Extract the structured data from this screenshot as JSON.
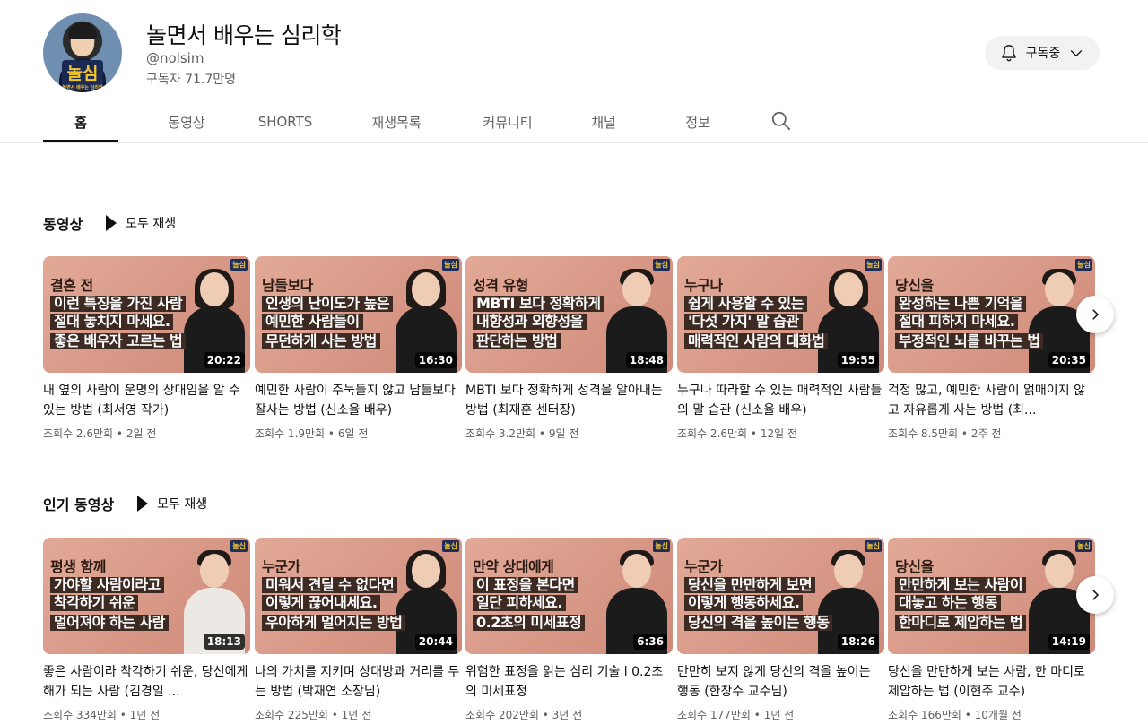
{
  "channel": {
    "avatar_text": "놀심",
    "avatar_subtext": "놀면서 배우는 심리학",
    "name": "놀면서 배우는 심리학",
    "handle": "@nolsim",
    "subscribers": "구독자 71.7만명",
    "subscribe_label": "구독중",
    "logo_badge": "놀심"
  },
  "tabs": [
    "홈",
    "동영상",
    "SHORTS",
    "재생목록",
    "커뮤니티",
    "채널",
    "정보"
  ],
  "icons": {
    "bell": "bell-icon",
    "chevron": "chevron-down-icon",
    "search": "search-icon",
    "play": "play-icon",
    "next": "chevron-right-icon"
  },
  "colors": {
    "thumb_bg": "#d79b8b",
    "text_secondary": "#606060",
    "subscribe_bg": "#f2f2f2"
  },
  "sections": [
    {
      "title": "동영상",
      "play_all": "모두 재생",
      "videos": [
        {
          "thumb_lines": [
            "결혼 전",
            "이런 특징을 가진 사람",
            "절대 놓치지 마세요.",
            "좋은 배우자 고르는 법"
          ],
          "duration": "20:22",
          "title": "내 옆의 사람이 운명의 상대임을 알 수 있는 방법 (최서영 작가)",
          "views": "조회수 2.6만회",
          "age": "2일 전"
        },
        {
          "thumb_lines": [
            "남들보다",
            "인생의 난이도가 높은",
            "예민한 사람들이",
            "무던하게 사는 방법"
          ],
          "duration": "16:30",
          "title": "예민한 사람이 주눅들지 않고 남들보다 잘사는 방법 (신소율 배우)",
          "views": "조회수 1.9만회",
          "age": "6일 전"
        },
        {
          "thumb_lines": [
            "성격 유형",
            "MBTI 보다 정확하게",
            "내향성과 외향성을",
            "판단하는 방법"
          ],
          "duration": "18:48",
          "title": "MBTI 보다 정확하게 성격을 알아내는 방법 (최재훈 센터장)",
          "views": "조회수 3.2만회",
          "age": "9일 전"
        },
        {
          "thumb_lines": [
            "누구나",
            "쉽게 사용할 수 있는",
            "'다섯 가지' 말 습관",
            "매력적인 사람의 대화법"
          ],
          "duration": "19:55",
          "title": "누구나 따라할 수 있는 매력적인 사람들의 말 습관 (신소율 배우)",
          "views": "조회수 2.6만회",
          "age": "12일 전"
        },
        {
          "thumb_lines": [
            "당신을",
            "완성하는 나쁜 기억을",
            "절대 피하지 마세요.",
            "부정적인 뇌를 바꾸는 법"
          ],
          "duration": "20:35",
          "title": "걱정 많고, 예민한 사람이 얽매이지 않고 자유롭게 사는 방법 (최...",
          "views": "조회수 8.5만회",
          "age": "2주 전"
        }
      ]
    },
    {
      "title": "인기 동영상",
      "play_all": "모두 재생",
      "videos": [
        {
          "thumb_lines": [
            "평생 함께",
            "가야할 사람이라고",
            "착각하기 쉬운",
            "멀어져야 하는 사람"
          ],
          "duration": "18:13",
          "title": "좋은 사람이라 착각하기 쉬운, 당신에게 해가 되는 사람 (김경일 ...",
          "views": "조회수 334만회",
          "age": "1년 전"
        },
        {
          "thumb_lines": [
            "누군가",
            "미워서 견딜 수 없다면",
            "이렇게 끊어내세요.",
            "우아하게 멀어지는 방법"
          ],
          "duration": "20:44",
          "title": "나의 가치를 지키며 상대방과 거리를 두는 방법 (박재연 소장님)",
          "views": "조회수 225만회",
          "age": "1년 전"
        },
        {
          "thumb_lines": [
            "만약 상대에게",
            "이 표정을 본다면",
            "일단 피하세요.",
            "0.2초의 미세표정"
          ],
          "duration": "6:36",
          "title": "위험한 표정을 읽는 심리 기술 l 0.2초의 미세표정",
          "views": "조회수 202만회",
          "age": "3년 전"
        },
        {
          "thumb_lines": [
            "누군가",
            "당신을 만만하게 보면",
            "이렇게 행동하세요.",
            "당신의 격을 높이는 행동"
          ],
          "duration": "18:26",
          "title": "만만히 보지 않게 당신의 격을 높이는 행동 (한창수 교수님)",
          "views": "조회수 177만회",
          "age": "1년 전"
        },
        {
          "thumb_lines": [
            "당신을",
            "만만하게 보는 사람이",
            "대놓고 하는 행동",
            "한마디로 제압하는 법"
          ],
          "duration": "14:19",
          "title": "당신을 만만하게 보는 사람, 한 마디로 제압하는 법 (이현주 교수)",
          "views": "조회수 166만회",
          "age": "10개월 전"
        }
      ]
    }
  ]
}
